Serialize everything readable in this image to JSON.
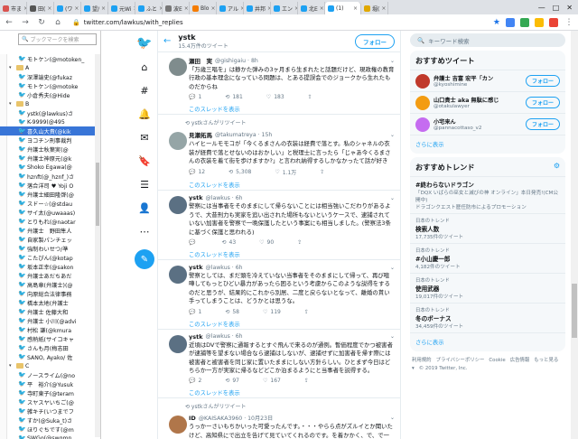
{
  "browser": {
    "tabs": [
      {
        "label": "市ま",
        "color": "#d9534f"
      },
      {
        "label": "田(",
        "color": "#555555"
      },
      {
        "label": "(ワ",
        "color": "#1da1f2"
      },
      {
        "label": "望/",
        "color": "#1da1f2"
      },
      {
        "label": "元Wi",
        "color": "#1da1f2"
      },
      {
        "label": "ふと",
        "color": "#1da1f2"
      },
      {
        "label": "波E",
        "color": "#777777"
      },
      {
        "label": "Blo",
        "color": "#f57c00"
      },
      {
        "label": "アル",
        "color": "#1da1f2"
      },
      {
        "label": "井邦",
        "color": "#1da1f2"
      },
      {
        "label": "エン",
        "color": "#1da1f2"
      },
      {
        "label": "北E",
        "color": "#1da1f2"
      },
      {
        "label": "(1)",
        "color": "#1da1f2",
        "active": true
      },
      {
        "label": "堀(",
        "color": "#e0a800"
      }
    ],
    "url": "twitter.com/lawkus/with_replies",
    "window_controls": [
      "—",
      "□",
      "✕"
    ]
  },
  "sidebar": {
    "search_placeholder": "ブックマークを検索",
    "items": [
      {
        "type": "bm",
        "label": "モトケン(@motoken_"
      },
      {
        "type": "folder",
        "label": "A"
      },
      {
        "type": "bm",
        "label": "深澤諭史(@fukaz"
      },
      {
        "type": "bm",
        "label": "モトケン(@motoke"
      },
      {
        "type": "bm",
        "label": "小倉秀夫(@Hide"
      },
      {
        "type": "folder",
        "label": "B"
      },
      {
        "type": "bm",
        "label": "ystk(@lawkus)さ"
      },
      {
        "type": "bm",
        "label": "K-9999(@495"
      },
      {
        "type": "bm",
        "label": "喜久山大貴(@kik",
        "selected": true
      },
      {
        "type": "bm",
        "label": "ヨコチン刑事裁判"
      },
      {
        "type": "bm",
        "label": "弁護士秋葉実(@"
      },
      {
        "type": "bm",
        "label": "弁護士神原元(@k"
      },
      {
        "type": "bm",
        "label": "Shoko Egawa(@"
      },
      {
        "type": "bm",
        "label": "hznft(@_hznf_)さ"
      },
      {
        "type": "bm",
        "label": "落合洋司 ♥ Yoji O"
      },
      {
        "type": "bm",
        "label": "弁護士細田隆啓(@"
      },
      {
        "type": "bm",
        "label": "スドー☆(@stdau"
      },
      {
        "type": "bm",
        "label": "サイ太(@uwaaas)"
      },
      {
        "type": "bm",
        "label": "とりもれ(@naotar"
      },
      {
        "type": "bm",
        "label": "弁護士　野田隼人"
      },
      {
        "type": "bm",
        "label": "自家製パンチェッ"
      },
      {
        "type": "bm",
        "label": "強制わいせつ/準"
      },
      {
        "type": "bm",
        "label": "こたぴん(@kotap"
      },
      {
        "type": "bm",
        "label": "坂本正幸(@sakon"
      },
      {
        "type": "bm",
        "label": "弁護士あだちあだ"
      },
      {
        "type": "bm",
        "label": "高島章(弁護士)(@"
      },
      {
        "type": "bm",
        "label": "向原総合法律事務"
      },
      {
        "type": "bm",
        "label": "橋本太地(弁護士"
      },
      {
        "type": "bm",
        "label": "弁護士 佐藤大和"
      },
      {
        "type": "bm",
        "label": "弁護士 小川(@advi"
      },
      {
        "type": "bm",
        "label": "村松 謙(@kmura"
      },
      {
        "type": "bm",
        "label": "感熱紙(サイコキャ"
      },
      {
        "type": "bm",
        "label": "さんも月(梅志田"
      },
      {
        "type": "bm",
        "label": "SANO, Ayako/ 佐"
      },
      {
        "type": "folder",
        "label": "C"
      },
      {
        "type": "bm",
        "label": "ノースライム(@no"
      },
      {
        "type": "bm",
        "label": "平　裕介(@Yusuk"
      },
      {
        "type": "bm",
        "label": "寺町東子(@teram"
      },
      {
        "type": "bm",
        "label": "スヤスヤいちご(@"
      },
      {
        "type": "bm",
        "label": "雑キチ(いつまでフ"
      },
      {
        "type": "bm",
        "label": "すか(@Suka_t)さ"
      },
      {
        "type": "bm",
        "label": "ほりぐちです(@m"
      },
      {
        "type": "bm",
        "label": "SWGo(@swgmn"
      }
    ]
  },
  "main": {
    "profile_name": "ystk",
    "tweet_count": "15.4万件のツイート",
    "follow_label": "フォロー",
    "tweets": [
      {
        "name": "瀬田　実",
        "handle": "@gishigaiu · 8h",
        "text": "「万歳三唱を」は静かた弾みの3ヶ月まら生まれたと話題だけど、現政権の教育行政の基本理念になっている問題は、とある提誤会でのジョークから生れたものだからね",
        "reply": "1",
        "rt": "181",
        "like": "183",
        "thread": "このスレッドを表示",
        "label": "ystkさんがリツイート"
      },
      {
        "name": "見瀬拓馬",
        "handle": "@takumatreya · 15h",
        "text": "ハイヒールモモコが「今くるまさんの衣装は経費で落とす。私のシャネルの衣装が経費で落とせないのはおかしい」と税理士に言ったら「じゃあ今くるまさんの衣装を着て街を歩けますか?」と言われ納得するしかなかったて話が好き",
        "reply": "12",
        "rt": "5,308",
        "like": "1.1万",
        "thread": "このスレッドを表示",
        "label": ""
      },
      {
        "name": "ystk",
        "handle": "@lawkus · 6h",
        "text": "警察には当事者をそのままにして帰らないことには相当強いこだわりがあるようで、大昔刑力も実家を追い出された場所もないというケースで、逮捕されていない加害者を警察で一晩保護したという事案にも相当しました。(警察法3条に基づく保護と思われる)",
        "reply": "",
        "rt": "43",
        "like": "90",
        "thread": "このスレッドを表示",
        "label": ""
      },
      {
        "name": "ystk",
        "handle": "@lawkus · 6h",
        "text": "警察としては、まだ頭を冷えていない当事者をそのままにして帰って、再び喧嘩してもっとひどい暴力があったら困るという考慮からこのような説得をするのだと思うが、結果的にこれから別居、二度と戻らないとなって、離婚の貰い手ってしまうことは、どうかとは思うな。",
        "reply": "1",
        "rt": "58",
        "like": "119",
        "thread": "このスレッドを表示",
        "label": ""
      },
      {
        "name": "ystk",
        "handle": "@lawkus · 6h",
        "text": "近頃はDVで警察に通報するとすぐ飛んで来るのが通例。暫価程度でかつ被害者が逮捕等を望まない場合なら逮捕はしないが、逮捕せずに加害者を帰す際には被害者と被害者を同じ家に置いたままにしない方針らしい。ひとまず今日はどちらか一方が実家に帰るなどどこか泊まるようにと当事者を説得する。",
        "reply": "2",
        "rt": "97",
        "like": "167",
        "thread": "このスレッドを表示",
        "label": "ystkさんがリツイート"
      },
      {
        "name": "ID",
        "handle": "@KAISAKA3960 · 10月23日",
        "text": "うっかーさいもちかいった可愛ったんです。・・・やらら点がズルイとか聞いたけど、高知県にで出立を告げて見ていてくれるのです。を着かかく、で、で一緒にいかかないもし入っておれ、見たい世の中の思い出にあわって生を喰う人の幸せがあてにて",
        "reply": "",
        "rt": "",
        "like": "",
        "thread": "",
        "label": ""
      }
    ]
  },
  "right": {
    "search_placeholder": "キーワード検索",
    "recommended_title": "おすすめツイート",
    "recommended": [
      {
        "name": "弁護士 吉富 宏平「カン",
        "handle": "@kyoshimine",
        "color": "#c0392b"
      },
      {
        "name": "山口貴士 aka 無駄に感じ",
        "handle": "@otakulawyer",
        "color": "#f39c12"
      },
      {
        "name": "小宅来ん",
        "handle": "@pannacottaso_v2",
        "color": "#c56cf0"
      }
    ],
    "follow_label": "フォロー",
    "more_label": "さらに表示",
    "trends_title": "おすすめトレンド",
    "trends": [
      {
        "cat": "",
        "name": "#終わらないドラゴン",
        "sub": "「DQX いばらの巫女と滅びの神 オンライン」本日発売!(CM公開中)",
        "promo": "ドラゴンクエスト歴任防市によるプロモーション"
      },
      {
        "cat": "日本のトレンド",
        "name": "検索人数",
        "sub": "17,735件のツイート",
        "promo": ""
      },
      {
        "cat": "日本のトレンド",
        "name": "#小山慶一郎",
        "sub": "4,182件のツイート",
        "promo": ""
      },
      {
        "cat": "日本のトレンド",
        "name": "使用武器",
        "sub": "19,017件のツイート",
        "promo": ""
      },
      {
        "cat": "日本のトレンド",
        "name": "冬のボーナス",
        "sub": "34,459件のツイート",
        "promo": ""
      }
    ],
    "footer": [
      "利用規約",
      "プライバシーポリシー",
      "Cookie",
      "広告情報",
      "もっと見る ▾",
      "© 2019 Twitter, Inc."
    ]
  }
}
